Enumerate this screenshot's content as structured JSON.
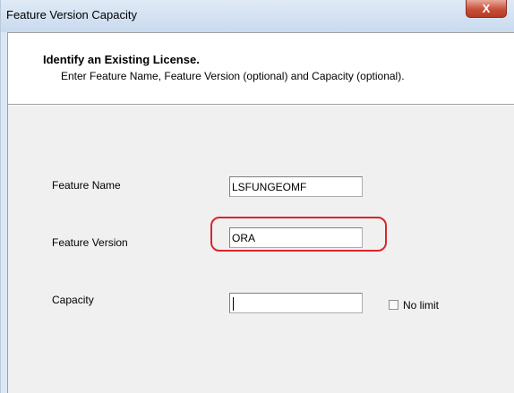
{
  "window": {
    "title": "Feature  Version Capacity",
    "close_glyph": "X"
  },
  "header": {
    "title": "Identify an Existing License.",
    "description": "Enter Feature Name, Feature Version (optional) and Capacity (optional)."
  },
  "form": {
    "feature_name": {
      "label": "Feature Name",
      "value": "LSFUNGEOMF"
    },
    "feature_version": {
      "label": "Feature Version",
      "value": "ORA"
    },
    "capacity": {
      "label": "Capacity",
      "value": ""
    },
    "no_limit": {
      "label": "No limit",
      "checked": false
    }
  },
  "colors": {
    "highlight_outline": "#d9262b",
    "close_button": "#c7503a"
  }
}
